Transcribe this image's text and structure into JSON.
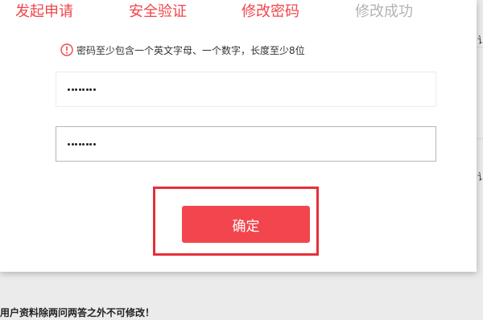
{
  "steps": [
    {
      "label": "发起申请",
      "state": "active"
    },
    {
      "label": "安全验证",
      "state": "active"
    },
    {
      "label": "修改密码",
      "state": "active"
    },
    {
      "label": "修改成功",
      "state": "done"
    }
  ],
  "hint": {
    "icon": "alert-circle-icon",
    "text": "密码至少包含一个英文字母、一个数字，长度至少8位"
  },
  "fields": [
    {
      "name": "new-password",
      "masked_length": 8
    },
    {
      "name": "confirm-password",
      "masked_length": 8
    }
  ],
  "confirm_button": {
    "label": "确定"
  },
  "background": {
    "edge_glyphs": [
      "讠",
      "讠"
    ],
    "note": "用户资料除两问两答之外不可修改！"
  },
  "colors": {
    "accent": "#f3454e",
    "step_active": "#f0454b",
    "step_done": "#b3b3b3",
    "highlight_border": "#e5303a"
  }
}
